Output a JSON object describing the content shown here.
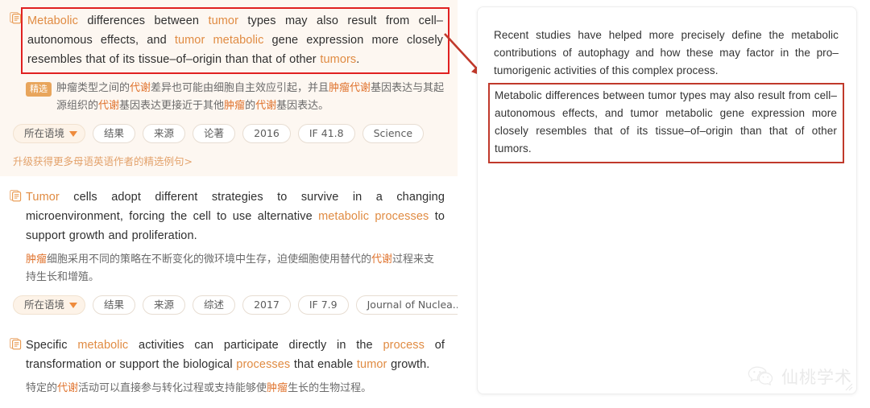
{
  "colors": {
    "accent_orange": "#e08b42",
    "badge_orange": "#e8a55c",
    "highlight_box_red": "#e02020",
    "arrow_red": "#c0392b",
    "featured_card_bg": "#fdf7f1",
    "pill_border": "#e7ddd2",
    "text_primary": "#2f2f2f",
    "text_zh": "#6b6b6b",
    "upgrade_link": "#e3a26b"
  },
  "results": [
    {
      "icon": "stacked-documents-icon",
      "featured": true,
      "boxed": true,
      "en_parts": [
        {
          "t": "Metabolic",
          "hl": true
        },
        {
          "t": " differences between ",
          "hl": false
        },
        {
          "t": "tumor",
          "hl": true
        },
        {
          "t": " types may also result from cell–autonomous effects, and ",
          "hl": false
        },
        {
          "t": "tumor metabolic",
          "hl": true
        },
        {
          "t": " gene expression more closely resembles that of its tissue–of–origin than that of other ",
          "hl": false
        },
        {
          "t": "tumors",
          "hl": true
        },
        {
          "t": ".",
          "hl": false
        }
      ],
      "badge": "精选",
      "zh_parts": [
        {
          "t": "肿瘤类型之间的",
          "hl": false
        },
        {
          "t": "代谢",
          "hl": true
        },
        {
          "t": "差异也可能由细胞自主效应引起，并且",
          "hl": false
        },
        {
          "t": "肿瘤代谢",
          "hl": true
        },
        {
          "t": "基因表达与其起源组织的",
          "hl": false
        },
        {
          "t": "代谢",
          "hl": true
        },
        {
          "t": "基因表达更接近于其他",
          "hl": false
        },
        {
          "t": "肿瘤",
          "hl": true
        },
        {
          "t": "的",
          "hl": false
        },
        {
          "t": "代谢",
          "hl": true
        },
        {
          "t": "基因表达。",
          "hl": false
        }
      ],
      "pills": [
        {
          "label": "所在语境",
          "dropdown": true
        },
        {
          "label": "结果",
          "dropdown": false
        },
        {
          "label": "来源",
          "dropdown": false
        },
        {
          "label": "论著",
          "dropdown": false
        },
        {
          "label": "2016",
          "dropdown": false
        },
        {
          "label": "IF 41.8",
          "dropdown": false
        },
        {
          "label": "Science",
          "dropdown": false
        }
      ],
      "upgrade_link": "升级获得更多母语英语作者的精选例句>"
    },
    {
      "icon": "stacked-documents-icon",
      "featured": false,
      "boxed": false,
      "en_parts": [
        {
          "t": "Tumor",
          "hl": true
        },
        {
          "t": " cells adopt different strategies to survive in a changing microenvironment, forcing the cell to use alternative ",
          "hl": false
        },
        {
          "t": "metabolic processes",
          "hl": true
        },
        {
          "t": " to support growth and proliferation.",
          "hl": false
        }
      ],
      "badge": null,
      "zh_parts": [
        {
          "t": "肿瘤",
          "hl": true
        },
        {
          "t": "细胞采用不同的策略在不断变化的微环境中生存，迫使细胞使用替代的",
          "hl": false
        },
        {
          "t": "代谢",
          "hl": true
        },
        {
          "t": "过程来支持生长和增殖。",
          "hl": false
        }
      ],
      "pills": [
        {
          "label": "所在语境",
          "dropdown": true
        },
        {
          "label": "结果",
          "dropdown": false
        },
        {
          "label": "来源",
          "dropdown": false
        },
        {
          "label": "综述",
          "dropdown": false
        },
        {
          "label": "2017",
          "dropdown": false
        },
        {
          "label": "IF 7.9",
          "dropdown": false
        },
        {
          "label": "Journal of Nuclea...",
          "dropdown": false
        }
      ],
      "upgrade_link": null
    },
    {
      "icon": "stacked-documents-icon",
      "featured": false,
      "boxed": false,
      "en_parts": [
        {
          "t": "Specific ",
          "hl": false
        },
        {
          "t": "metabolic",
          "hl": true
        },
        {
          "t": " activities can participate directly in the ",
          "hl": false
        },
        {
          "t": "process",
          "hl": true
        },
        {
          "t": " of transformation or support the biological ",
          "hl": false
        },
        {
          "t": "processes",
          "hl": true
        },
        {
          "t": " that enable ",
          "hl": false
        },
        {
          "t": "tumor",
          "hl": true
        },
        {
          "t": " growth.",
          "hl": false
        }
      ],
      "badge": null,
      "zh_parts": [
        {
          "t": "特定的",
          "hl": false
        },
        {
          "t": "代谢",
          "hl": true
        },
        {
          "t": "活动可以直接参与转化过程或支持能够使",
          "hl": false
        },
        {
          "t": "肿瘤",
          "hl": true
        },
        {
          "t": "生长的生物过程。",
          "hl": false
        }
      ],
      "pills": [],
      "upgrade_link": null
    }
  ],
  "preview": {
    "paragraphs": [
      {
        "boxed": false,
        "text": "Recent studies have helped more precisely define the metabolic contributions of autophagy and how these may factor in the pro–tumorigenic activities of this complex process."
      },
      {
        "boxed": true,
        "text": "Metabolic differences between tumor types may also result from cell–autonomous effects, and tumor metabolic gene expression more closely resembles that of its tissue–of–origin than that of other tumors."
      }
    ]
  },
  "watermark": {
    "icon": "wechat-icon",
    "text": "仙桃学术"
  }
}
